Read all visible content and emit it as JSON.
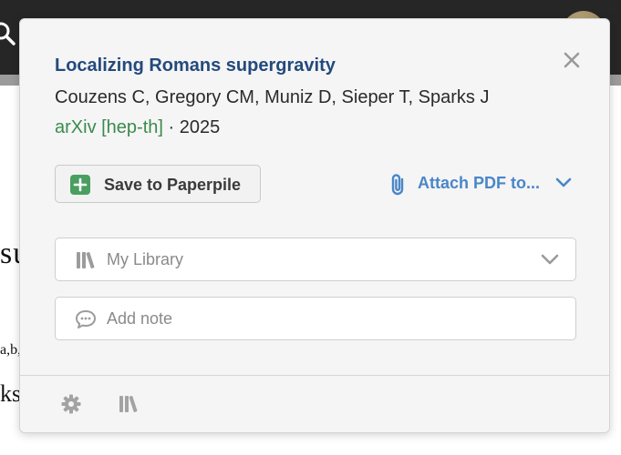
{
  "background": {
    "text_1": "su",
    "text_2": "a,b,",
    "text_3": "ks"
  },
  "popup": {
    "title": "Localizing Romans supergravity",
    "authors": "Couzens C, Gregory CM, Muniz D, Sieper T, Sparks J",
    "venue": "arXiv [hep-th]",
    "separator": " · ",
    "year": "2025",
    "save_label": "Save to Paperpile",
    "attach_label": "Attach PDF to...",
    "library_placeholder": "My Library",
    "note_placeholder": "Add note"
  },
  "colors": {
    "title": "#234a7c",
    "venue": "#3b8a4e",
    "accent_blue": "#4a86c8",
    "save_icon": "#4a9e60"
  },
  "icons": {
    "close": "close-icon",
    "save": "plus-square-icon",
    "attach": "paperclip-icon",
    "library": "library-books-icon",
    "note": "speech-bubble-icon",
    "settings": "gear-icon",
    "search": "search-icon"
  }
}
